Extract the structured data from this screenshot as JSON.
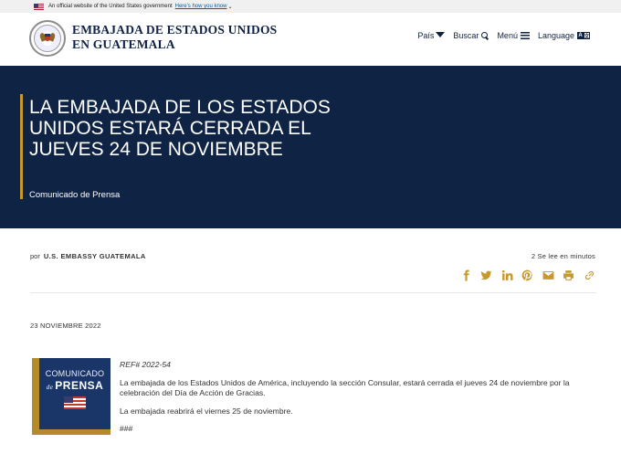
{
  "gov_banner": {
    "text": "An official website of the United States government",
    "link": "Here's how you know"
  },
  "header": {
    "site_title_line1": "EMBAJADA DE ESTADOS UNIDOS",
    "site_title_line2": "EN GUATEMALA",
    "nav": {
      "pais": "País",
      "buscar": "Buscar",
      "menu": "Menú",
      "language": "Language"
    }
  },
  "hero": {
    "title": "LA EMBAJADA DE LOS ESTADOS UNIDOS ESTARÁ CERRADA EL JUEVES 24 DE NOVIEMBRE",
    "subtitle": "Comunicado de Prensa"
  },
  "byline": {
    "prefix": "por",
    "author": "U.S. EMBASSY GUATEMALA",
    "read_time": "2 Se lee en minutos"
  },
  "share_icons": [
    "facebook-icon",
    "twitter-icon",
    "linkedin-icon",
    "pinterest-icon",
    "email-icon",
    "print-icon",
    "link-icon"
  ],
  "date": "23 NOVIEMBRE 2022",
  "press_image": {
    "line1": "COMUNICADO",
    "line2_prefix": "de",
    "line2": "PRENSA"
  },
  "article": {
    "ref": "REF# 2022-54",
    "p1": "La embajada de los Estados Unidos de América, incluyendo la sección Consular, estará cerrada el jueves 24 de noviembre por la celebración del Día de Acción de Gracias.",
    "p2": "La embajada reabrirá el viernes 25 de noviembre.",
    "end": "###"
  },
  "colors": {
    "navy": "#0f2344",
    "gold": "#c7992d"
  }
}
